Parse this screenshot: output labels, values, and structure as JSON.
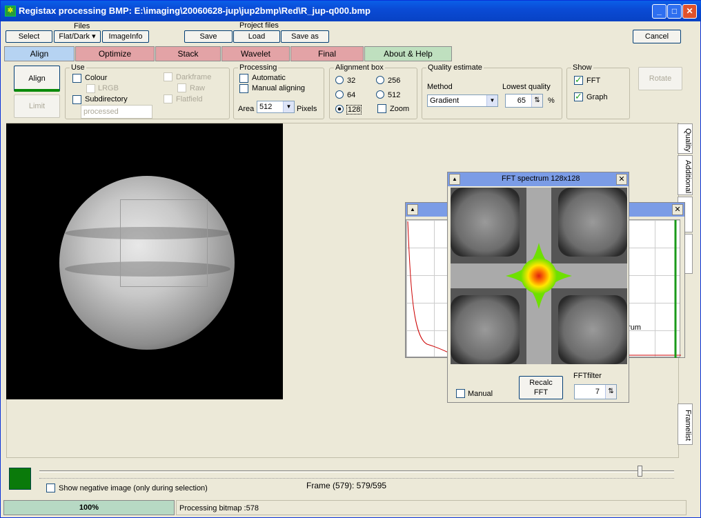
{
  "window": {
    "title": "Registax processing BMP: E:\\imaging\\20060628-jup\\jup2bmp\\Red\\R_jup-q000.bmp"
  },
  "toolbar": {
    "files_label": "Files",
    "project_files_label": "Project files",
    "select": "Select",
    "flatdark": "Flat/Dark ▾",
    "imageinfo": "ImageInfo",
    "save": "Save",
    "load": "Load",
    "save_as": "Save as",
    "cancel": "Cancel"
  },
  "tabs": [
    "Align",
    "Optimize",
    "Stack",
    "Wavelet",
    "Final",
    "About & Help"
  ],
  "align_panel": {
    "align_btn": "Align",
    "limit_btn": "Limit",
    "use_label": "Use",
    "colour": "Colour",
    "lrgb": "LRGB",
    "subdirectory": "Subdirectory",
    "subdir_value": "processed",
    "darkframe": "Darkframe",
    "raw": "Raw",
    "flatfield": "Flatfield",
    "processing_label": "Processing",
    "automatic": "Automatic",
    "manual_aligning": "Manual aligning",
    "area_label": "Area",
    "area_value": "512",
    "pixels_label": "Pixels",
    "alignbox_label": "Alignment box",
    "box_options": [
      "32",
      "256",
      "64",
      "512",
      "128"
    ],
    "zoom": "Zoom",
    "quality_label": "Quality estimate",
    "method_label": "Method",
    "method_value": "Gradient",
    "lowest_quality_label": "Lowest quality",
    "lowest_quality_value": "65",
    "percent": "%",
    "show_label": "Show",
    "fft": "FFT",
    "graph": "Graph",
    "rotate": "Rotate"
  },
  "side_tabs": {
    "quality": "Quality",
    "additional": "Additional",
    "framelist": "Framelist"
  },
  "fft_window": {
    "title": "FFT spectrum 128x128",
    "manual": "Manual",
    "recalc_line1": "Recalc",
    "recalc_line2": "FFT",
    "fftfilter_label": "FFTfilter",
    "fftfilter_value": "7"
  },
  "graph_window": {
    "partial_label": "trum"
  },
  "bottom": {
    "show_negative": "Show negative image (only during selection)",
    "frame_text": "Frame (579): 579/595",
    "slider_position": 0.946,
    "progress_text": "100%",
    "progress_value": 1.0,
    "status_text": "Processing bitmap :578"
  }
}
